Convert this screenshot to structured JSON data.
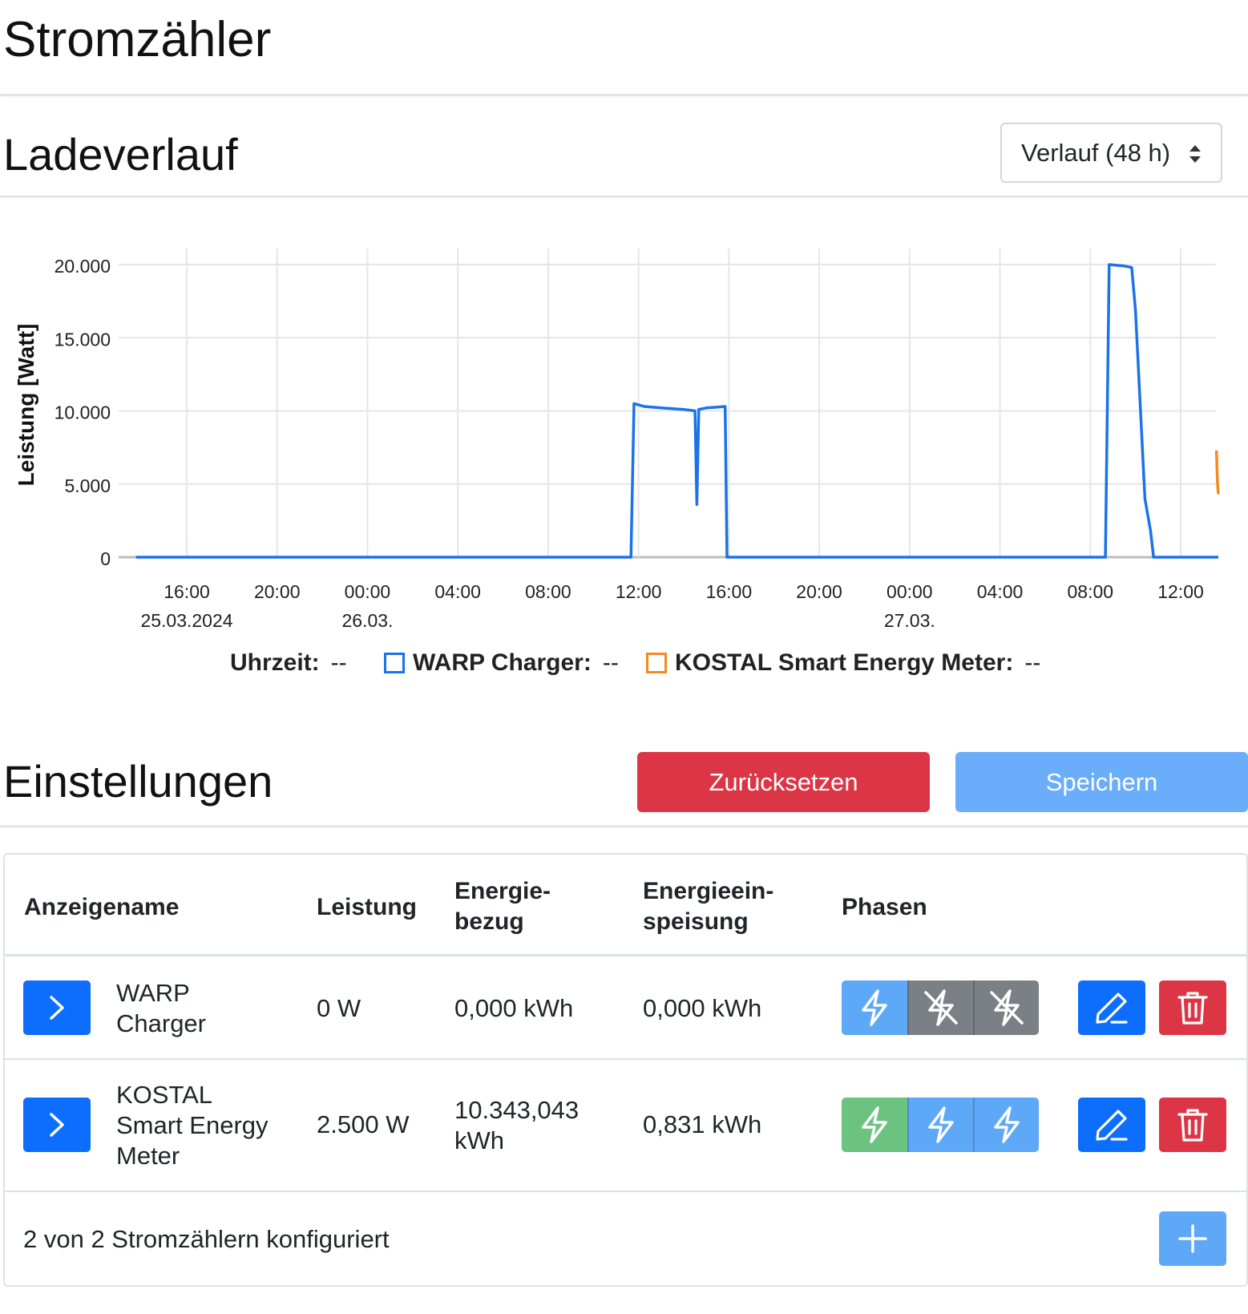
{
  "page_title": "Stromzähler",
  "history": {
    "title": "Ladeverlauf",
    "range_select": "Verlauf (48 h)"
  },
  "legend": {
    "time_label": "Uhrzeit:",
    "time_value": "--",
    "series1_label": "WARP Charger:",
    "series1_value": "--",
    "series2_label": "KOSTAL Smart Energy Meter:",
    "series2_value": "--"
  },
  "chart_data": {
    "type": "line",
    "ylabel": "Leistung [Watt]",
    "ylim": [
      0,
      20000
    ],
    "y_ticks": [
      "0",
      "5.000",
      "10.000",
      "15.000",
      "20.000"
    ],
    "x_tick_labels": [
      "16:00",
      "20:00",
      "00:00",
      "04:00",
      "08:00",
      "12:00",
      "16:00",
      "20:00",
      "00:00",
      "04:00",
      "08:00",
      "12:00"
    ],
    "x_date_labels": [
      {
        "at": "16:00",
        "label": "25.03.2024"
      },
      {
        "at": "00:00",
        "label": "26.03."
      },
      {
        "at": "00:00",
        "label": "27.03."
      }
    ],
    "x_range_hours": [
      "2024-03-25 13:45",
      "2024-03-27 13:40"
    ],
    "grid": true,
    "legend_position": "bottom",
    "series": [
      {
        "name": "WARP Charger",
        "color": "#1a73e8",
        "points": [
          [
            "2024-03-25 13:45",
            0
          ],
          [
            "2024-03-26 11:40",
            0
          ],
          [
            "2024-03-26 11:48",
            10500
          ],
          [
            "2024-03-26 12:15",
            10300
          ],
          [
            "2024-03-26 13:00",
            10200
          ],
          [
            "2024-03-26 14:00",
            10100
          ],
          [
            "2024-03-26 14:30",
            10000
          ],
          [
            "2024-03-26 14:35",
            3600
          ],
          [
            "2024-03-26 14:40",
            10100
          ],
          [
            "2024-03-26 15:00",
            10200
          ],
          [
            "2024-03-26 15:50",
            10300
          ],
          [
            "2024-03-26 15:55",
            0
          ],
          [
            "2024-03-27 08:40",
            0
          ],
          [
            "2024-03-27 08:50",
            20000
          ],
          [
            "2024-03-27 09:30",
            19900
          ],
          [
            "2024-03-27 09:50",
            19800
          ],
          [
            "2024-03-27 10:00",
            16900
          ],
          [
            "2024-03-27 10:25",
            4000
          ],
          [
            "2024-03-27 10:40",
            1800
          ],
          [
            "2024-03-27 10:48",
            0
          ],
          [
            "2024-03-27 13:40",
            0
          ]
        ]
      },
      {
        "name": "KOSTAL Smart Energy Meter",
        "color": "#f58a1f",
        "points": [
          [
            "2024-03-27 13:35",
            7300
          ],
          [
            "2024-03-27 13:38",
            5000
          ],
          [
            "2024-03-27 13:40",
            4300
          ]
        ]
      }
    ]
  },
  "settings": {
    "title": "Einstellungen",
    "reset_label": "Zurücksetzen",
    "save_label": "Speichern",
    "table": {
      "headers": {
        "name": "Anzeigename",
        "power": "Leistung",
        "import1": "Energie-",
        "import2": "bezug",
        "export1": "Energieein-",
        "export2": "speisung",
        "phases": "Phasen"
      },
      "rows": [
        {
          "name1": "WARP",
          "name2": "Charger",
          "power": "0 W",
          "import1": "0,000 kWh",
          "import2": "",
          "export": "0,000 kWh",
          "phases": [
            "active",
            "inactive",
            "inactive"
          ]
        },
        {
          "name1": "KOSTAL",
          "name2": "Smart Energy",
          "name3": "Meter",
          "power": "2.500 W",
          "import1": "10.343,043",
          "import2": "kWh",
          "export": "0,831 kWh",
          "phases": [
            "feed",
            "active",
            "active"
          ]
        }
      ],
      "footer": "2 von 2 Stromzählern konfiguriert"
    }
  },
  "colors": {
    "primary": "#0d6efd",
    "danger": "#dc3545",
    "phase_active": "#5ea8f8",
    "phase_inactive": "#7b8086",
    "phase_feed": "#6cc380"
  }
}
